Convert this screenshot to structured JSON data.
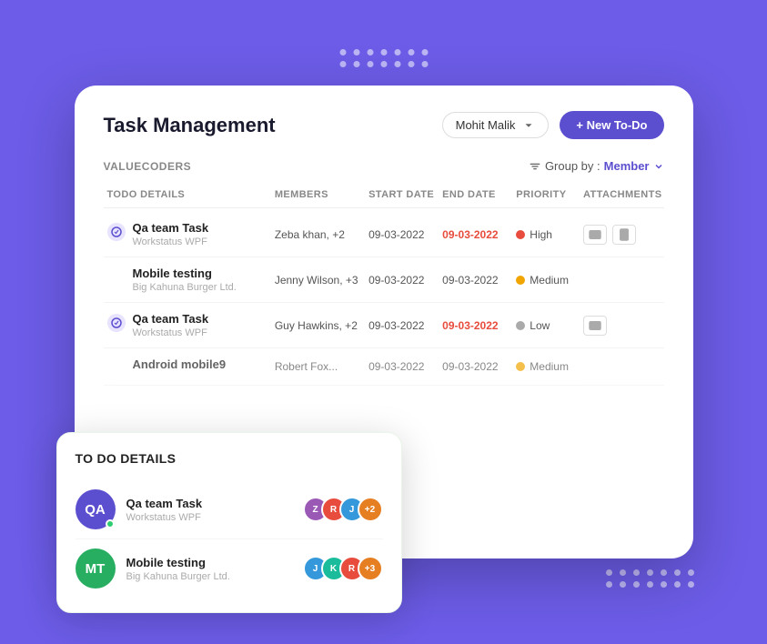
{
  "app": {
    "title": "Task Management",
    "org": "VALUECODERS"
  },
  "header": {
    "user_dropdown_label": "Mohit Malik",
    "new_todo_label": "+ New To-Do",
    "group_by_label": "Group by :",
    "group_by_value": "Member"
  },
  "table": {
    "columns": [
      "TODO DETAILS",
      "MEMBERS",
      "START DATE",
      "END DATE",
      "PRIORITY",
      "ATTACHMENTS"
    ],
    "rows": [
      {
        "task_name": "Qa team Task",
        "task_sub": "Workstatus WPF",
        "members": "Zeba khan, +2",
        "start_date": "09-03-2022",
        "end_date": "09-03-2022",
        "end_date_red": true,
        "priority": "High",
        "priority_level": "high",
        "has_image_attach": true,
        "has_doc_attach": true,
        "has_icon": true
      },
      {
        "task_name": "Mobile testing",
        "task_sub": "Big Kahuna Burger Ltd.",
        "members": "Jenny Wilson, +3",
        "start_date": "09-03-2022",
        "end_date": "09-03-2022",
        "end_date_red": false,
        "priority": "Medium",
        "priority_level": "medium",
        "has_image_attach": false,
        "has_doc_attach": false,
        "has_icon": false
      },
      {
        "task_name": "Qa team Task",
        "task_sub": "Workstatus WPF",
        "members": "Guy Hawkins, +2",
        "start_date": "09-03-2022",
        "end_date": "09-03-2022",
        "end_date_red": true,
        "priority": "Low",
        "priority_level": "low",
        "has_image_attach": true,
        "has_doc_attach": false,
        "has_icon": true
      },
      {
        "task_name": "Android mobile9",
        "task_sub": "",
        "members": "Robert Fox...",
        "start_date": "09-03-2022",
        "end_date": "09-03-2022",
        "end_date_red": false,
        "priority": "Medium",
        "priority_level": "medium",
        "has_image_attach": false,
        "has_doc_attach": false,
        "has_icon": false
      }
    ]
  },
  "popup": {
    "title": "TO DO DETAILS",
    "items": [
      {
        "initials": "QA",
        "avatar_class": "avatar-qa",
        "task_name": "Qa team Task",
        "task_sub": "Workstatus WPF",
        "online": true
      },
      {
        "initials": "MT",
        "avatar_class": "avatar-mt",
        "task_name": "Mobile testing",
        "task_sub": "Big Kahuna Burger Ltd.",
        "online": false
      }
    ]
  }
}
